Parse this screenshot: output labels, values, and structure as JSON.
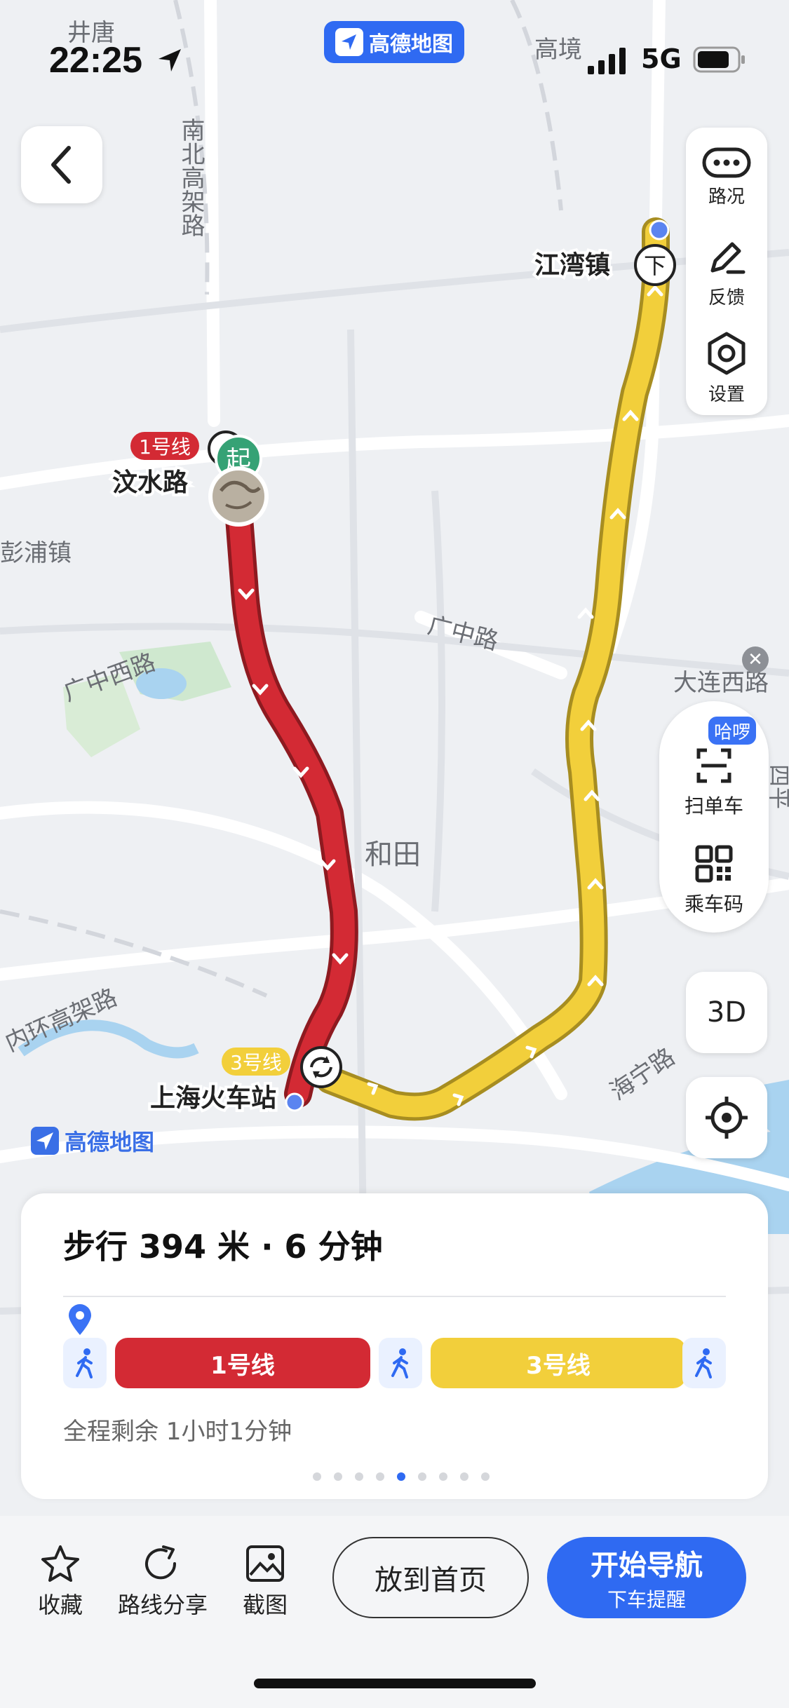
{
  "status_bar": {
    "time": "22:25",
    "network": "5G",
    "app_badge": "高德地图"
  },
  "map": {
    "place_labels": {
      "jingtang": "井唐",
      "gaojing": "高境",
      "nanbei_road": "南北高架路",
      "wenshui_road": "汶水路",
      "pengpu": "彭浦镇",
      "guangzhong_west": "广中西路",
      "guangzhong_road": "广中路",
      "hetian": "和田",
      "neihuan": "内环高架路",
      "haining": "海宁路",
      "shanghai_station": "上海火车站",
      "jiangwan": "江湾镇",
      "dalian_west": "大连西路",
      "siping": "四平"
    },
    "line_badges": {
      "line1": "1号线",
      "line3": "3号线"
    },
    "markers": {
      "start": "起",
      "alight": "下"
    },
    "watermark": "高德地图",
    "colors": {
      "line1": "#d32a34",
      "line3": "#f2cf3b",
      "accent": "#2f6af2"
    }
  },
  "side_panel": {
    "traffic": "路况",
    "feedback": "反馈",
    "settings": "设置"
  },
  "ride_panel": {
    "hello_badge": "哈啰",
    "scan": "扫单车",
    "code": "乘车码"
  },
  "btn_3d": "3D",
  "route_card": {
    "title": "步行  394 米 · 6 分钟",
    "segments": {
      "line1": "1号线",
      "line3": "3号线"
    },
    "remaining": "全程剩余 1小时1分钟",
    "page_index": 5,
    "page_count": 9
  },
  "bottom_bar": {
    "favorite": "收藏",
    "share": "路线分享",
    "screenshot": "截图",
    "home": "放到首页",
    "nav_main": "开始导航",
    "nav_sub": "下车提醒"
  }
}
